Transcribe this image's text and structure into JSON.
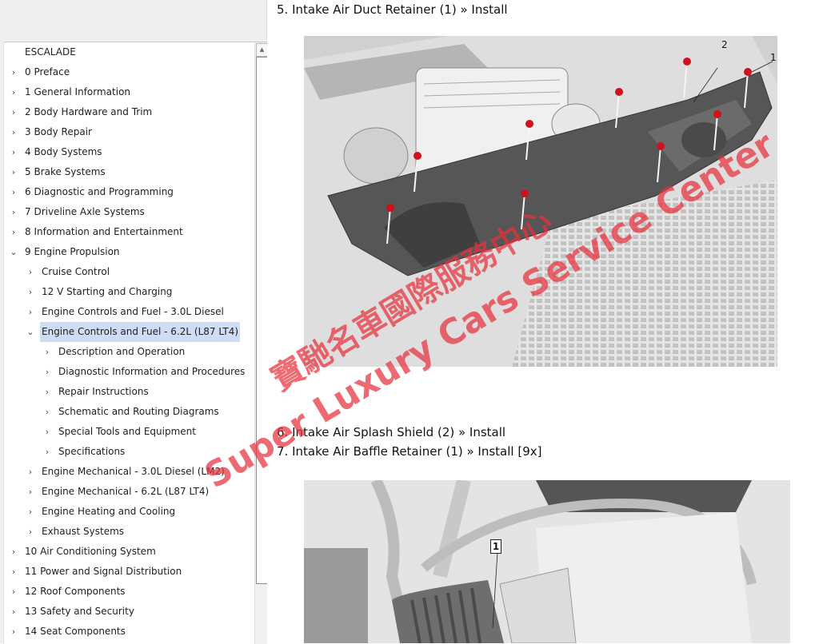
{
  "tree": {
    "root": "ESCALADE",
    "items": [
      {
        "label": "0 Preface",
        "level": 0,
        "state": "collapsed"
      },
      {
        "label": "1 General Information",
        "level": 0,
        "state": "collapsed"
      },
      {
        "label": "2 Body Hardware and Trim",
        "level": 0,
        "state": "collapsed"
      },
      {
        "label": "3 Body Repair",
        "level": 0,
        "state": "collapsed"
      },
      {
        "label": "4 Body Systems",
        "level": 0,
        "state": "collapsed"
      },
      {
        "label": "5 Brake Systems",
        "level": 0,
        "state": "collapsed"
      },
      {
        "label": "6 Diagnostic and Programming",
        "level": 0,
        "state": "collapsed"
      },
      {
        "label": "7 Driveline Axle Systems",
        "level": 0,
        "state": "collapsed"
      },
      {
        "label": "8 Information and Entertainment",
        "level": 0,
        "state": "collapsed"
      },
      {
        "label": "9 Engine Propulsion",
        "level": 0,
        "state": "expanded"
      },
      {
        "label": "Cruise Control",
        "level": 1,
        "state": "collapsed"
      },
      {
        "label": "12 V Starting and Charging",
        "level": 1,
        "state": "collapsed"
      },
      {
        "label": "Engine Controls and Fuel - 3.0L Diesel",
        "level": 1,
        "state": "collapsed"
      },
      {
        "label": "Engine Controls and Fuel - 6.2L (L87  LT4)",
        "level": 1,
        "state": "expanded",
        "selected": true
      },
      {
        "label": "Description and Operation",
        "level": 2,
        "state": "collapsed"
      },
      {
        "label": "Diagnostic Information and Procedures",
        "level": 2,
        "state": "collapsed"
      },
      {
        "label": "Repair Instructions",
        "level": 2,
        "state": "collapsed"
      },
      {
        "label": "Schematic and Routing Diagrams",
        "level": 2,
        "state": "collapsed"
      },
      {
        "label": "Special Tools and Equipment",
        "level": 2,
        "state": "collapsed"
      },
      {
        "label": "Specifications",
        "level": 2,
        "state": "collapsed"
      },
      {
        "label": "Engine Mechanical - 3.0L Diesel (LM2)",
        "level": 1,
        "state": "collapsed"
      },
      {
        "label": "Engine Mechanical - 6.2L (L87  LT4)",
        "level": 1,
        "state": "collapsed"
      },
      {
        "label": "Engine Heating and Cooling",
        "level": 1,
        "state": "collapsed"
      },
      {
        "label": "Exhaust Systems",
        "level": 1,
        "state": "collapsed"
      },
      {
        "label": "10 Air Conditioning System",
        "level": 0,
        "state": "collapsed"
      },
      {
        "label": "11 Power and Signal Distribution",
        "level": 0,
        "state": "collapsed"
      },
      {
        "label": "12 Roof Components",
        "level": 0,
        "state": "collapsed"
      },
      {
        "label": "13 Safety and Security",
        "level": 0,
        "state": "collapsed"
      },
      {
        "label": "14 Seat Components",
        "level": 0,
        "state": "collapsed"
      }
    ],
    "glyphs": {
      "collapsed": "›",
      "expanded": "⌄"
    }
  },
  "content": {
    "steps": [
      {
        "text": "5. Intake Air Duct Retainer (1) » Install"
      },
      {
        "text": "6. Intake Air Splash Shield (2) » Install"
      },
      {
        "text": "7. Intake Air Baffle Retainer (1) » Install [9x]"
      }
    ],
    "figure1": {
      "callouts": [
        "1",
        "2"
      ],
      "description": "Intake air duct retainer with red fasteners above radiator grille"
    },
    "figure2": {
      "callouts": [
        "1"
      ],
      "description": "Intake air baffle retainer on air intake duct"
    }
  },
  "watermark": {
    "line1": "寶馳名車國際服務中心",
    "line2": "Super Luxury Cars Service Center",
    "color": "#e8303c"
  },
  "colors": {
    "selection": "#cfdcf5",
    "fastener": "#d0101c"
  }
}
